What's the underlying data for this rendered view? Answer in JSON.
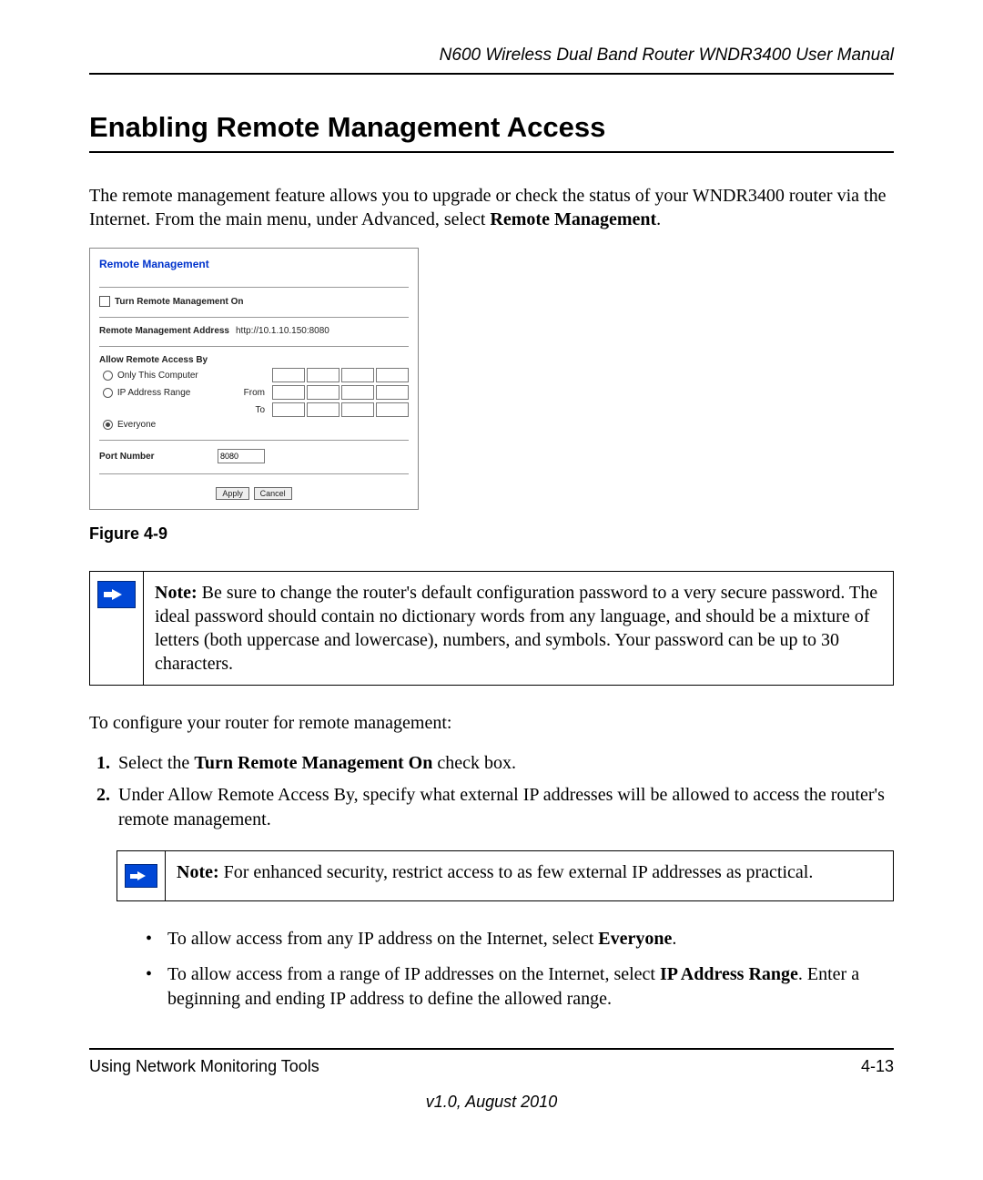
{
  "header": {
    "manual_title": "N600 Wireless Dual Band Router WNDR3400 User Manual"
  },
  "section": {
    "title": "Enabling Remote Management Access",
    "intro_part1": "The remote management feature allows you to upgrade or check the status of your WNDR3400 router via the Internet. From the main menu, under Advanced, select ",
    "intro_bold": "Remote Management",
    "intro_part2": "."
  },
  "screenshot": {
    "panel_title": "Remote Management",
    "checkbox_label": "Turn Remote Management On",
    "address_label": "Remote Management Address",
    "address_value": "http://10.1.10.150:8080",
    "allow_label": "Allow Remote Access By",
    "radio_only": "Only This Computer",
    "radio_range": "IP Address Range",
    "from_label": "From",
    "to_label": "To",
    "radio_everyone": "Everyone",
    "port_label": "Port Number",
    "port_value": "8080",
    "apply_btn": "Apply",
    "cancel_btn": "Cancel"
  },
  "figure_caption": "Figure 4-9",
  "note1": {
    "label": "Note:",
    "text": " Be sure to change the router's default configuration password to a very secure password. The ideal password should contain no dictionary words from any language, and should be a mixture of letters (both uppercase and lowercase), numbers, and symbols. Your password can be up to 30 characters."
  },
  "configure_intro": "To configure your router for remote management:",
  "steps": {
    "one_a": "Select the ",
    "one_b": "Turn Remote Management On",
    "one_c": " check box.",
    "two": "Under Allow Remote Access By, specify what external IP addresses will be allowed to access the router's remote management."
  },
  "note2": {
    "label": "Note:",
    "text": " For enhanced security, restrict access to as few external IP addresses as practical."
  },
  "bullets": {
    "b1_a": "To allow access from any IP address on the Internet, select ",
    "b1_b": "Everyone",
    "b1_c": ".",
    "b2_a": "To allow access from a range of IP addresses on the Internet, select ",
    "b2_b": "IP Address Range",
    "b2_c": ". Enter a beginning and ending IP address to define the allowed range."
  },
  "footer": {
    "section": "Using Network Monitoring Tools",
    "page": "4-13",
    "version": "v1.0, August 2010"
  }
}
